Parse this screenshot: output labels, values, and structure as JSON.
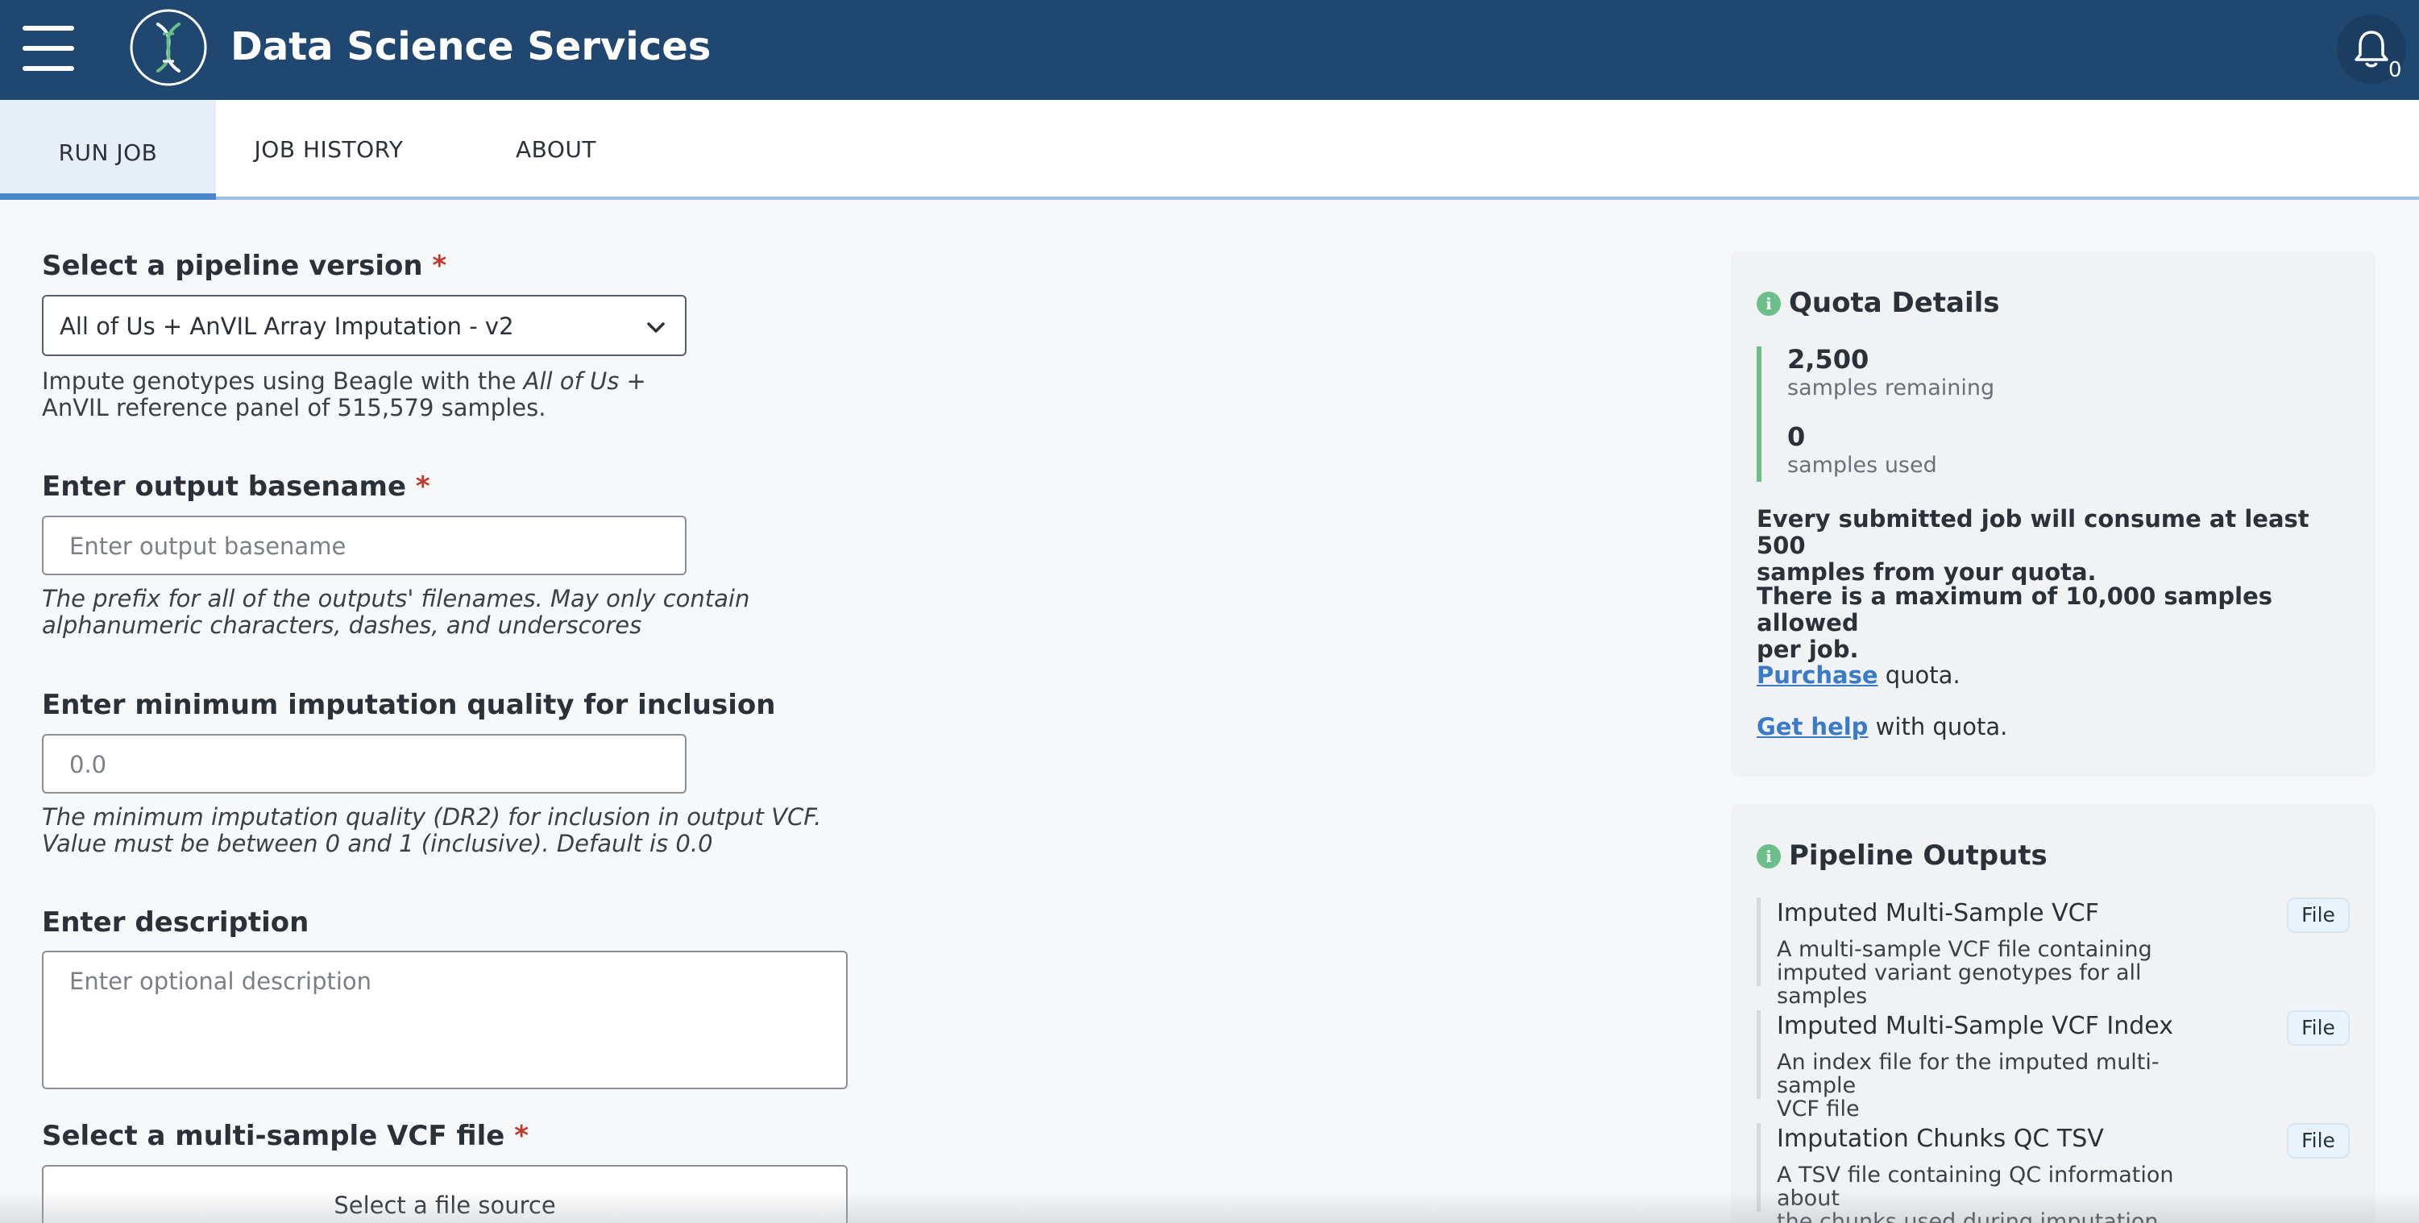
{
  "header": {
    "title": "Data Science Services",
    "notification_count": "0",
    "colors": {
      "background": "#1f4770",
      "accent": "#6dbf8a"
    }
  },
  "tabs": [
    {
      "label": "RUN JOB",
      "active": true
    },
    {
      "label": "JOB HISTORY",
      "active": false
    },
    {
      "label": "ABOUT",
      "active": false
    }
  ],
  "form": {
    "pipeline": {
      "label": "Select a pipeline version",
      "required_mark": "*",
      "value": "All of Us + AnVIL Array Imputation - v2",
      "help_part1": "Impute genotypes using Beagle with the ",
      "help_italic": "All of Us",
      "help_part2": " +",
      "help_line2": "AnVIL reference panel of 515,579 samples."
    },
    "basename": {
      "label": "Enter output basename",
      "required_mark": "*",
      "placeholder": "Enter output basename",
      "help_line1": "The prefix for all of the outputs' filenames. May only contain",
      "help_line2": "alphanumeric characters, dashes, and underscores"
    },
    "quality": {
      "label": "Enter minimum imputation quality for inclusion",
      "placeholder": "0.0",
      "help_line1": "The minimum imputation quality (DR2) for inclusion in output VCF.",
      "help_line2": "Value must be between 0 and 1 (inclusive). Default is 0.0"
    },
    "description": {
      "label": "Enter description",
      "placeholder": "Enter optional description"
    },
    "vcf": {
      "label": "Select a multi-sample VCF file",
      "required_mark": "*",
      "button": "Select a file source"
    }
  },
  "quota": {
    "title": "Quota Details",
    "remaining_value": "2,500",
    "remaining_label": "samples remaining",
    "used_value": "0",
    "used_label": "samples used",
    "note1_line1": "Every submitted job will consume at least 500",
    "note1_line2": "samples from your quota.",
    "note2_line1": "There is a maximum of 10,000 samples allowed",
    "note2_line2": "per job.",
    "purchase_link": "Purchase",
    "purchase_suffix": " quota.",
    "help_link": "Get help",
    "help_suffix": " with quota."
  },
  "outputs": {
    "title": "Pipeline Outputs",
    "items": [
      {
        "name": "Imputed Multi-Sample VCF",
        "desc_line1": "A multi-sample VCF file containing",
        "desc_line2": "imputed variant genotypes for all samples",
        "badge": "File"
      },
      {
        "name": "Imputed Multi-Sample VCF Index",
        "desc_line1": "An index file for the imputed multi-sample",
        "desc_line2": "VCF file",
        "badge": "File"
      },
      {
        "name": "Imputation Chunks QC TSV",
        "desc_line1": "A TSV file containing QC information about",
        "desc_line2": "the chunks used during imputation",
        "badge": "File"
      }
    ]
  }
}
